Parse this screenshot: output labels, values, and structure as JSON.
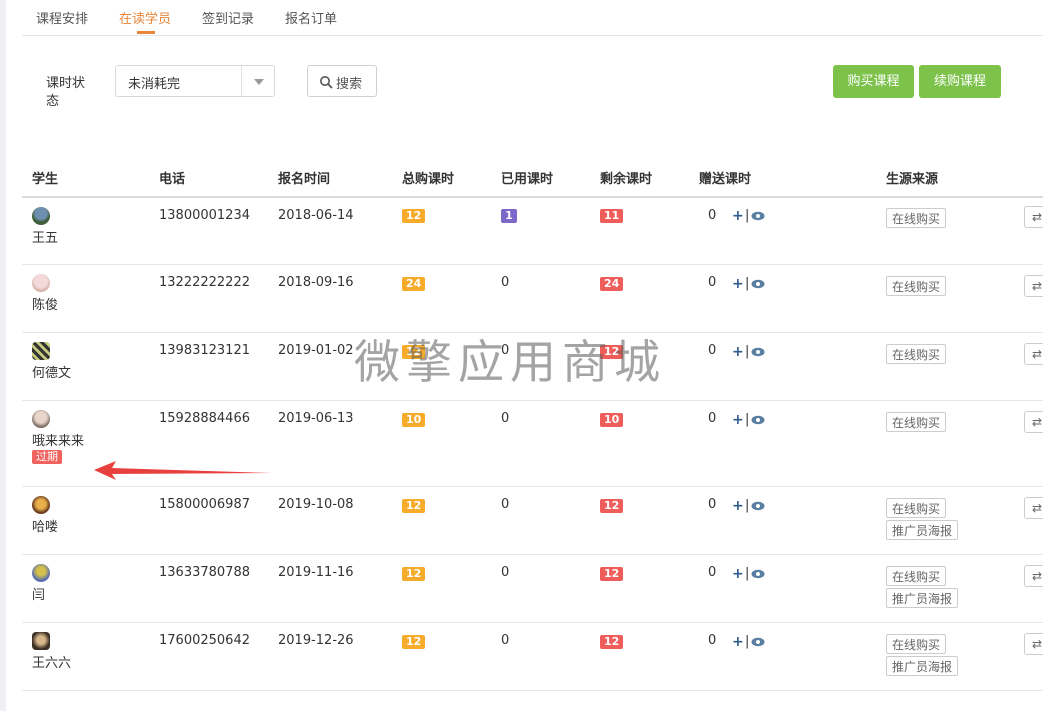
{
  "tabs": [
    {
      "label": "课程安排",
      "active": false
    },
    {
      "label": "在读学员",
      "active": true
    },
    {
      "label": "签到记录",
      "active": false
    },
    {
      "label": "报名订单",
      "active": false
    }
  ],
  "filter": {
    "label": "课时状态",
    "select_value": "未消耗完",
    "search_label": "搜索",
    "search_icon": "search-icon"
  },
  "buttons": {
    "buy_course": "购买课程",
    "renew_course": "续购课程"
  },
  "colors": {
    "accent": "#e8863a",
    "green": "#7dc24b",
    "badge_orange": "#f6ac2a",
    "badge_purple": "#7b68c9",
    "badge_red": "#ef5d5a"
  },
  "table": {
    "columns": [
      "学生",
      "电话",
      "报名时间",
      "总购课时",
      "已用课时",
      "剩余课时",
      "赠送课时",
      "生源来源"
    ],
    "rows": [
      {
        "name": "王五",
        "phone": "13800001234",
        "date": "2018-06-14",
        "total": "12",
        "used": "1",
        "remaining": "11",
        "gift": "0",
        "sources": [
          "在线购买"
        ],
        "expired": ""
      },
      {
        "name": "陈俊",
        "phone": "13222222222",
        "date": "2018-09-16",
        "total": "24",
        "used": "0",
        "remaining": "24",
        "gift": "0",
        "sources": [
          "在线购买"
        ],
        "expired": ""
      },
      {
        "name": "何德文",
        "phone": "13983123121",
        "date": "2019-01-02",
        "total": "12",
        "used": "0",
        "remaining": "12",
        "gift": "0",
        "sources": [
          "在线购买"
        ],
        "expired": ""
      },
      {
        "name": "哦来来来",
        "phone": "15928884466",
        "date": "2019-06-13",
        "total": "10",
        "used": "0",
        "remaining": "10",
        "gift": "0",
        "sources": [
          "在线购买"
        ],
        "expired": "过期"
      },
      {
        "name": "哈喽",
        "phone": "15800006987",
        "date": "2019-10-08",
        "total": "12",
        "used": "0",
        "remaining": "12",
        "gift": "0",
        "sources": [
          "在线购买",
          "推广员海报"
        ],
        "expired": ""
      },
      {
        "name": "闫",
        "phone": "13633780788",
        "date": "2019-11-16",
        "total": "12",
        "used": "0",
        "remaining": "12",
        "gift": "0",
        "sources": [
          "在线购买",
          "推广员海报"
        ],
        "expired": ""
      },
      {
        "name": "王六六",
        "phone": "17600250642",
        "date": "2019-12-26",
        "total": "12",
        "used": "0",
        "remaining": "12",
        "gift": "0",
        "sources": [
          "在线购买",
          "推广员海报"
        ],
        "expired": ""
      }
    ]
  },
  "watermark": "微擎应用商城"
}
